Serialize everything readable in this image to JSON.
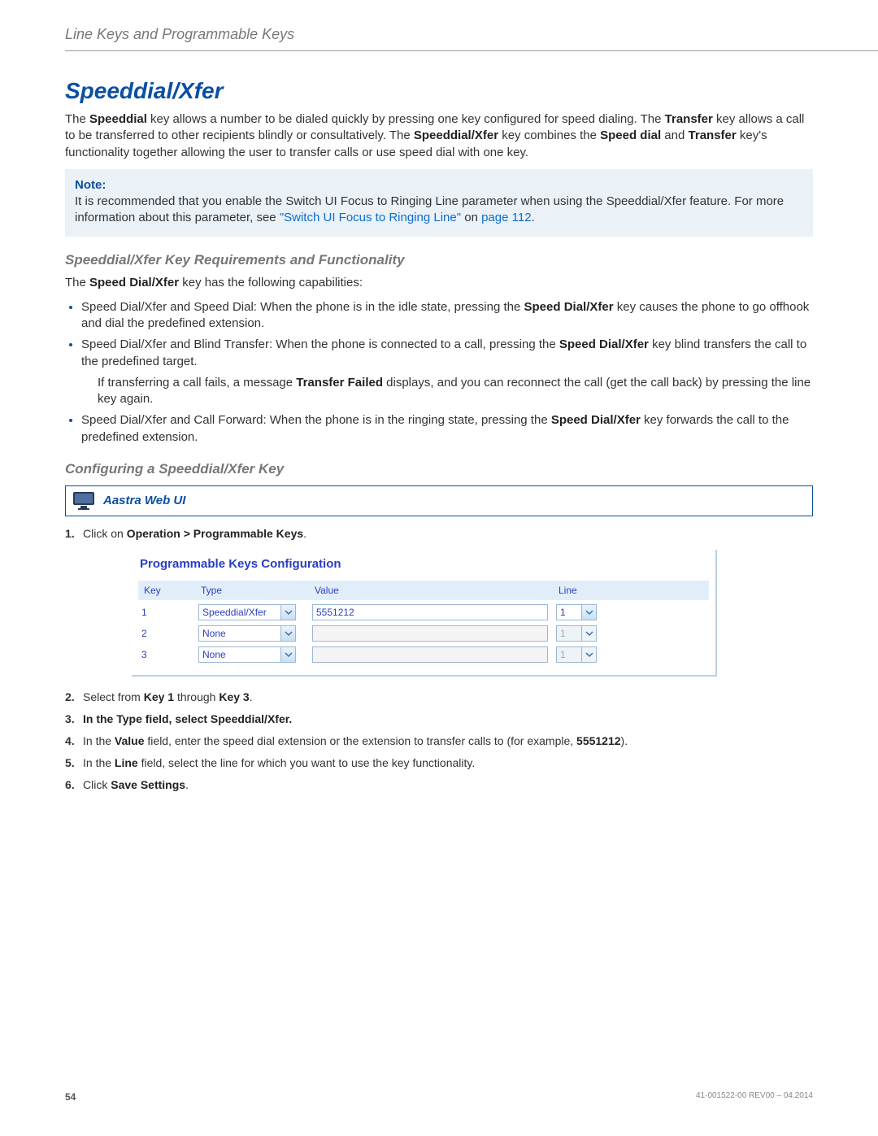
{
  "header": {
    "breadcrumb": "Line Keys and Programmable Keys"
  },
  "title": "Speeddial/Xfer",
  "intro": {
    "p1a": "The ",
    "p1b": "Speeddial",
    "p1c": " key allows a number to be dialed quickly by pressing one key configured for speed dialing. The ",
    "p1d": "Transfer",
    "p1e": " key allows a call to be transferred to other recipients blindly or consultatively. The ",
    "p1f": "Speeddial/Xfer",
    "p1g": " key combines the ",
    "p1h": "Speed dial",
    "p1i": " and ",
    "p1j": "Transfer",
    "p1k": " key's functionality together allowing the user to transfer calls or use speed dial with one key."
  },
  "note": {
    "label": "Note:",
    "text": "It is recommended that you enable the Switch UI Focus to Ringing Line parameter when using the Speeddial/Xfer feature. For more information about this parameter, see ",
    "link": "\"Switch UI Focus to Ringing Line\"",
    "after": " on ",
    "pageref": "page 112",
    "dot": "."
  },
  "reqs": {
    "heading": "Speeddial/Xfer Key Requirements and Functionality",
    "lead_a": "The ",
    "lead_b": "Speed Dial/Xfer",
    "lead_c": " key has the following capabilities:",
    "b1a": "Speed Dial/Xfer and Speed Dial: When the phone is in the idle state, pressing the ",
    "b1b": "Speed Dial/Xfer",
    "b1c": " key causes the phone to go offhook and dial the predefined extension.",
    "b2a": "Speed Dial/Xfer and Blind Transfer: When the phone is connected to a call, pressing the ",
    "b2b": "Speed Dial/Xfer",
    "b2c": " key blind transfers the call to the predefined target.",
    "b2_note_a": "If transferring a call fails, a message ",
    "b2_note_b": "Transfer Failed",
    "b2_note_c": " displays, and you can reconnect the call (get the call back) by pressing the line key again.",
    "b3a": "Speed Dial/Xfer and Call Forward: When the phone is in the ringing state, pressing the ",
    "b3b": "Speed Dial/Xfer",
    "b3c": " key forwards the call to the predefined extension."
  },
  "config": {
    "heading": "Configuring a Speeddial/Xfer Key",
    "webui_label": "Aastra Web UI",
    "steps": {
      "s1a": "Click on ",
      "s1b": "Operation > Programmable Keys",
      "s1c": ".",
      "s2a": "Select from ",
      "s2b": "Key 1",
      "s2c": " through ",
      "s2d": "Key 3",
      "s2e": ".",
      "s3a": "In the ",
      "s3b": "Type",
      "s3c": " field, select ",
      "s3d": "Speeddial/Xfer",
      "s3e": ".",
      "s4a": "In the ",
      "s4b": "Value",
      "s4c": " field, enter the speed dial extension or the extension to transfer calls to (for example, ",
      "s4d": "5551212",
      "s4e": ").",
      "s5a": "In the ",
      "s5b": "Line",
      "s5c": " field, select the line for which you want to use the key functionality.",
      "s6a": "Click ",
      "s6b": "Save Settings",
      "s6c": "."
    }
  },
  "pk": {
    "title": "Programmable Keys Configuration",
    "cols": {
      "key": "Key",
      "type": "Type",
      "value": "Value",
      "line": "Line"
    },
    "rows": [
      {
        "key": "1",
        "type": "Speeddial/Xfer",
        "value": "5551212",
        "line": "1",
        "line_enabled": true,
        "value_active": true
      },
      {
        "key": "2",
        "type": "None",
        "value": "",
        "line": "1",
        "line_enabled": false,
        "value_active": false
      },
      {
        "key": "3",
        "type": "None",
        "value": "",
        "line": "1",
        "line_enabled": false,
        "value_active": false
      }
    ]
  },
  "footer": {
    "page": "54",
    "rev": "41-001522-00 REV00 – 04.2014"
  }
}
